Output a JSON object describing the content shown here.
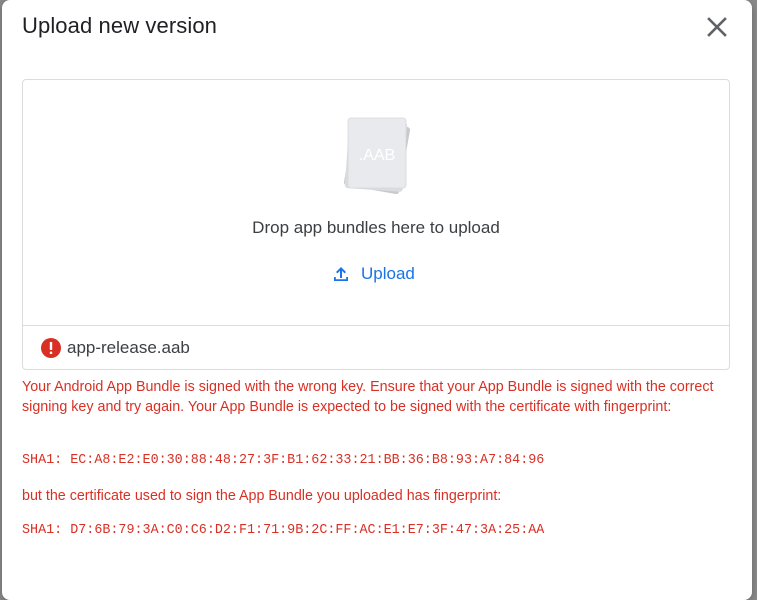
{
  "dialog": {
    "title": "Upload new version"
  },
  "dropzone": {
    "file_badge": ".AAB",
    "drop_text": "Drop app bundles here to upload",
    "upload_label": "Upload"
  },
  "file": {
    "name": "app-release.aab",
    "status_icon": "error-icon"
  },
  "error": {
    "message": "Your Android App Bundle is signed with the wrong key. Ensure that your App Bundle is signed with the correct signing key and try again. Your App Bundle is expected to be signed with the certificate with fingerprint:",
    "expected_sha": "SHA1: EC:A8:E2:E0:30:88:48:27:3F:B1:62:33:21:BB:36:B8:93:A7:84:96",
    "message2": "but the certificate used to sign the App Bundle you uploaded has fingerprint:",
    "actual_sha": "SHA1: D7:6B:79:3A:C0:C6:D2:F1:71:9B:2C:FF:AC:E1:E7:3F:47:3A:25:AA"
  },
  "colors": {
    "accent": "#1a73e8",
    "error": "#d93025"
  }
}
